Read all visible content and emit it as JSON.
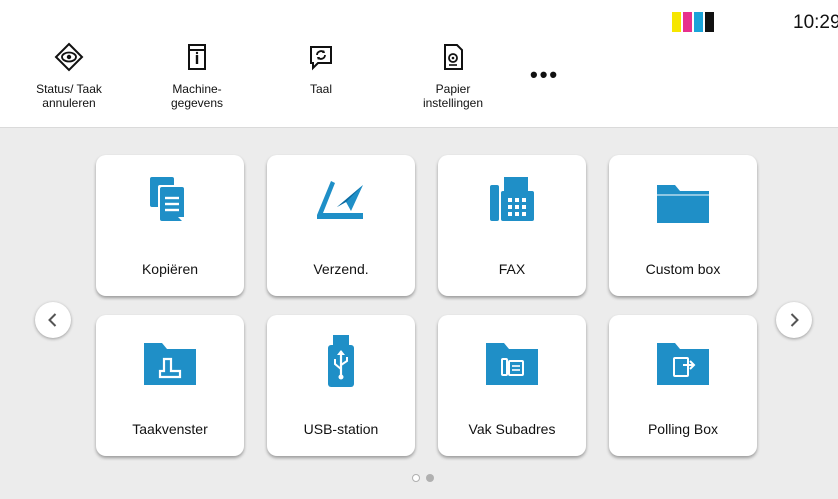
{
  "status_bar": {
    "time": "10:29",
    "toner_colors": [
      "#f6e600",
      "#e7308c",
      "#1aa3d9",
      "#111111"
    ]
  },
  "toolbar": {
    "items": [
      {
        "label": "Status/ Taak\nannuleren",
        "icon": "eye-diamond-icon"
      },
      {
        "label": "Machine-\ngegevens",
        "icon": "machine-info-icon"
      },
      {
        "label": "Taal",
        "icon": "language-refresh-icon"
      },
      {
        "label": "Papier\ninstellingen",
        "icon": "paper-settings-icon"
      }
    ],
    "more_label": "•••"
  },
  "tiles": [
    {
      "label": "Kopiëren",
      "icon": "copy-icon"
    },
    {
      "label": "Verzend.",
      "icon": "send-icon"
    },
    {
      "label": "FAX",
      "icon": "fax-icon"
    },
    {
      "label": "Custom box",
      "icon": "folder-icon"
    },
    {
      "label": "Taakvenster",
      "icon": "job-box-icon"
    },
    {
      "label": "USB-station",
      "icon": "usb-icon"
    },
    {
      "label": "Vak Subadres",
      "icon": "subaddress-box-icon"
    },
    {
      "label": "Polling Box",
      "icon": "polling-box-icon"
    }
  ],
  "accent_color": "#1f8fc7",
  "pagination": {
    "current": 1,
    "total": 2
  }
}
